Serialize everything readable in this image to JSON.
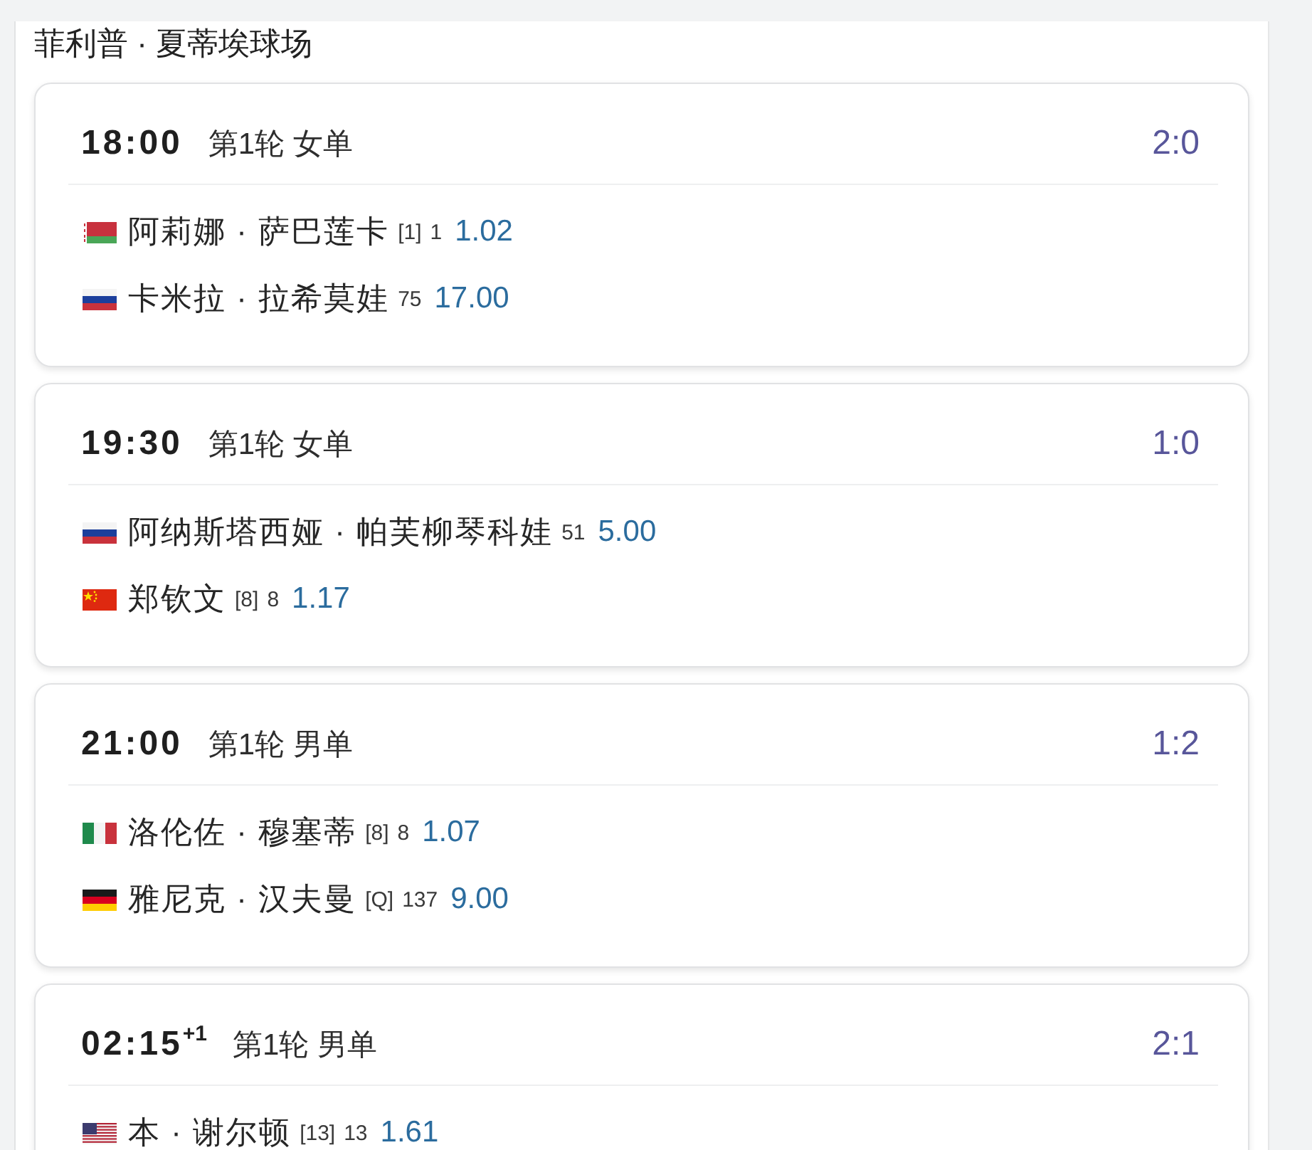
{
  "venue": {
    "title": "菲利普 · 夏蒂埃球场"
  },
  "matches": [
    {
      "time": "18:00",
      "round": "第1轮 女单",
      "score": "2:0",
      "players": [
        {
          "kind": "belarus",
          "name": "阿莉娜 · 萨巴莲卡",
          "seed": "[1]",
          "rank": "1",
          "odds": "1.02"
        },
        {
          "kind": "russia",
          "name": "卡米拉 · 拉希莫娃",
          "rank": "75",
          "odds": "17.00"
        }
      ]
    },
    {
      "time": "19:30",
      "round": "第1轮 女单",
      "score": "1:0",
      "players": [
        {
          "kind": "russia",
          "name": "阿纳斯塔西娅 · 帕芙柳琴科娃",
          "rank": "51",
          "odds": "5.00"
        },
        {
          "kind": "china",
          "name": "郑钦文",
          "seed": "[8]",
          "rank": "8",
          "odds": "1.17"
        }
      ]
    },
    {
      "time": "21:00",
      "round": "第1轮 男单",
      "score": "1:2",
      "players": [
        {
          "kind": "italy",
          "name": "洛伦佐 · 穆塞蒂",
          "seed": "[8]",
          "rank": "8",
          "odds": "1.07"
        },
        {
          "kind": "germany",
          "name": "雅尼克 · 汉夫曼",
          "seed": "[Q]",
          "rank": "137",
          "odds": "9.00"
        }
      ]
    },
    {
      "time": "02:15$^{+1}$",
      "round": "第1轮 男单",
      "score": "2:1",
      "players": [
        {
          "kind": "usa",
          "name": "本 · 谢尔顿",
          "seed": "[13]",
          "rank": "13",
          "odds": "1.61"
        }
      ]
    }
  ]
}
